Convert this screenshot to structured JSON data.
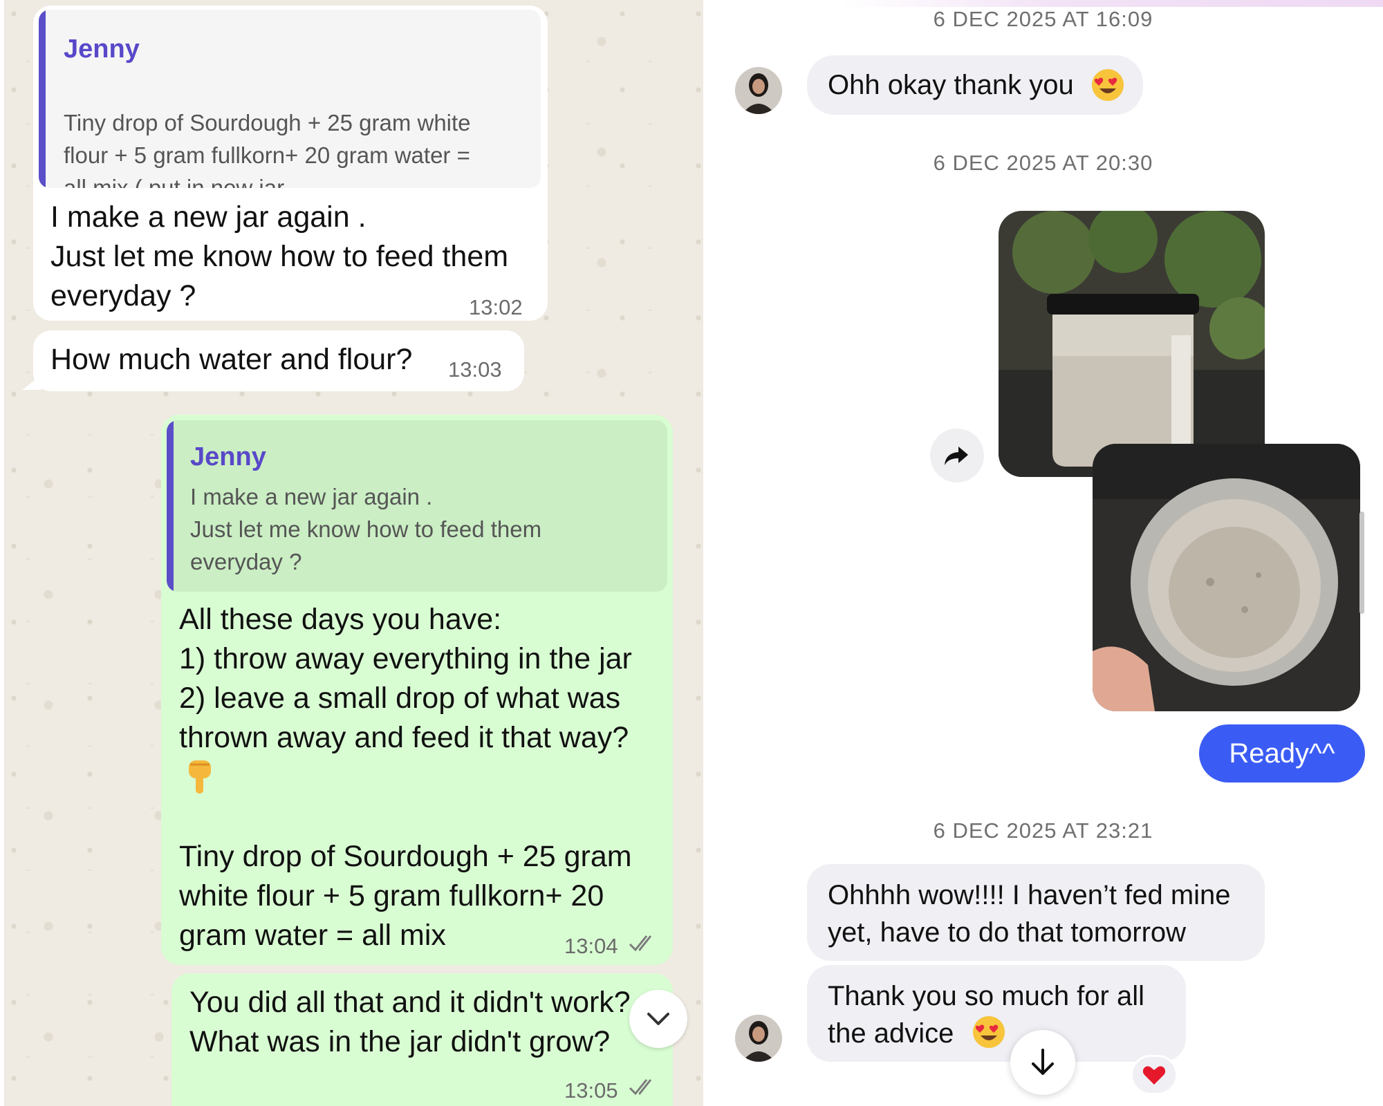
{
  "whatsapp": {
    "messages": [
      {
        "quote": {
          "author": "Jenny",
          "text": "Tiny drop of Sourdough + 25 gram white\nflour + 5 gram fullkorn+ 20 gram water =\nall mix ( put in new jar"
        },
        "text": "I make a new jar again .\nJust let me know how to feed them\neveryday ?",
        "time": "13:02"
      },
      {
        "text": "How much water and flour?",
        "time": "13:03"
      },
      {
        "quote": {
          "author": "Jenny",
          "text": "I make a new jar again .\nJust let me know how to feed them\neveryday ?"
        },
        "text": "All these days you have:\n1) throw away everything in the jar\n2) leave a small drop of what was\nthrown away and feed it that way?",
        "text2": "Tiny drop of Sourdough + 25 gram\nwhite flour + 5 gram fullkorn+ 20\ngram water = all mix",
        "time": "13:04"
      },
      {
        "text": "You did all that and it didn't work?\nWhat was in the jar didn't grow?",
        "time": "13:05"
      }
    ]
  },
  "instagram": {
    "date_1": "6 DEC 2025 AT 16:09",
    "msg_1": "Ohh okay thank you",
    "date_2": "6 DEC 2025 AT 20:30",
    "ready": "Ready^^",
    "date_3": "6 DEC 2025 AT 23:21",
    "msg_2": "Ohhhh wow!!!! I haven’t fed mine\nyet, have to do that tomorrow",
    "msg_3": "Thank you so much for all\nthe advice"
  },
  "icons": {
    "jar": "jar-icon",
    "pointing_down": "backhand-index-pointing-down-icon",
    "heart_eyes": "smiling-face-with-heart-eyes-icon",
    "read_ticks": "double-check-icon",
    "share": "share-arrow-icon",
    "heart": "red-heart-icon",
    "chevron_down": "chevron-down-icon",
    "arrow_down": "arrow-down-icon"
  },
  "colors": {
    "whatsapp_background": "#efeae2",
    "incoming_bubble": "#ffffff",
    "outgoing_bubble": "#d9fdd3",
    "quote_bar": "#5a4ec9",
    "instagram_bubble": "#efeff4",
    "instagram_sent": "#3b5cf4"
  }
}
